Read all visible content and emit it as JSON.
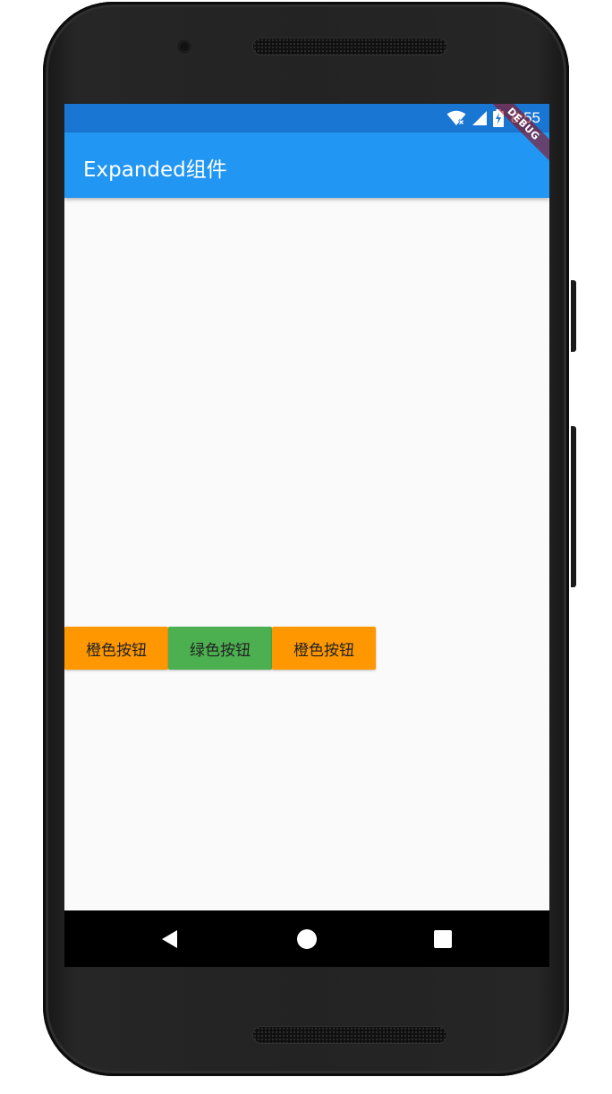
{
  "status_bar": {
    "time": "8:55",
    "icons": [
      "wifi-icon",
      "signal-icon",
      "battery-charging-icon"
    ],
    "color": "#1976d2"
  },
  "debug_banner": "DEBUG",
  "app_bar": {
    "title": "Expanded组件",
    "color": "#2196f3"
  },
  "buttons": [
    {
      "label": "橙色按钮",
      "color": "#ff9800"
    },
    {
      "label": "绿色按钮",
      "color": "#4caf50"
    },
    {
      "label": "橙色按钮",
      "color": "#ff9800"
    }
  ],
  "nav_bar": {
    "icons": [
      "back-icon",
      "home-icon",
      "recent-apps-icon"
    ]
  }
}
